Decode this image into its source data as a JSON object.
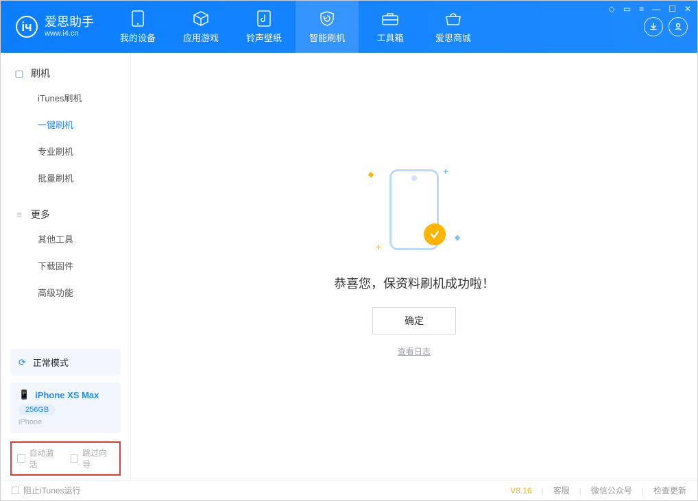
{
  "app": {
    "name_cn": "爱思助手",
    "name_en": "www.i4.cn"
  },
  "tabs": [
    {
      "label": "我的设备"
    },
    {
      "label": "应用游戏"
    },
    {
      "label": "铃声壁纸"
    },
    {
      "label": "智能刷机"
    },
    {
      "label": "工具箱"
    },
    {
      "label": "爱思商城"
    }
  ],
  "sidebar": {
    "section1_title": "刷机",
    "items1": [
      {
        "label": "iTunes刷机"
      },
      {
        "label": "一键刷机"
      },
      {
        "label": "专业刷机"
      },
      {
        "label": "批量刷机"
      }
    ],
    "section2_title": "更多",
    "items2": [
      {
        "label": "其他工具"
      },
      {
        "label": "下载固件"
      },
      {
        "label": "高级功能"
      }
    ],
    "mode_label": "正常模式",
    "device_name": "iPhone XS Max",
    "device_capacity": "256GB",
    "device_type": "iPhone",
    "opt_auto_activate": "自动激活",
    "opt_skip_guide": "跳过向导"
  },
  "main": {
    "headline": "恭喜您，保资料刷机成功啦！",
    "ok_button": "确定",
    "view_log": "查看日志"
  },
  "footer": {
    "block_itunes": "阻止iTunes运行",
    "version": "V8.16",
    "support": "客服",
    "wechat": "微信公众号",
    "update": "检查更新"
  }
}
